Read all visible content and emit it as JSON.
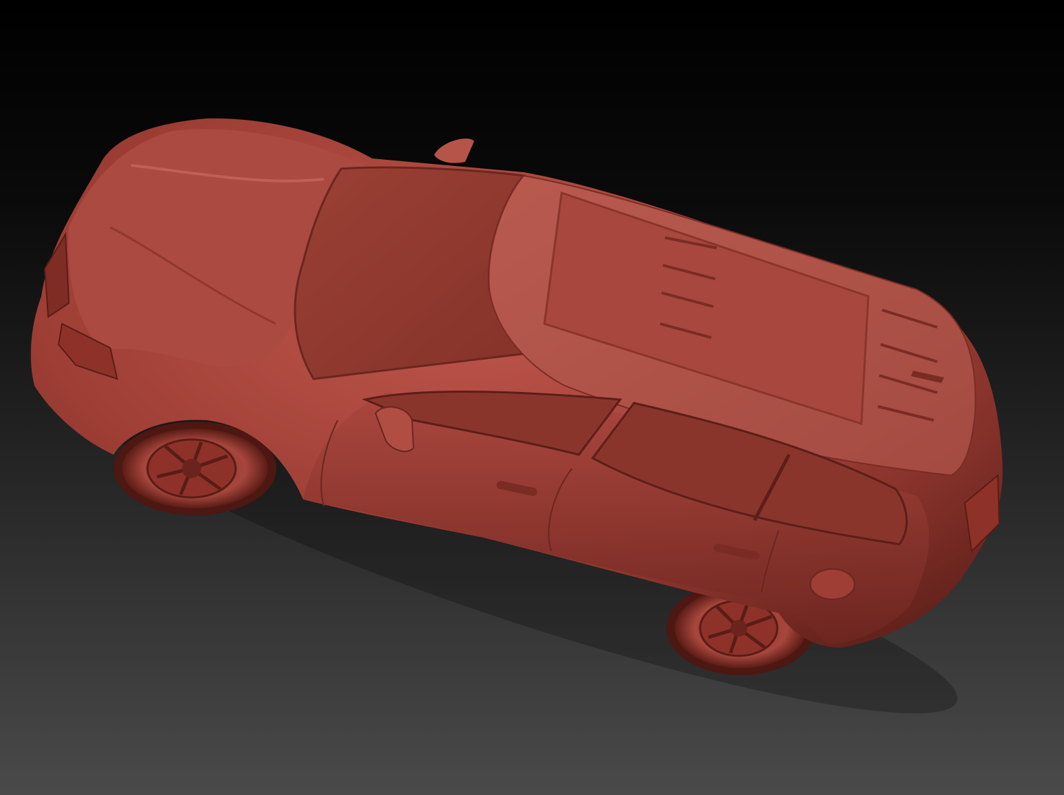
{
  "viewport": {
    "background_top": "#000000",
    "background_bottom": "#4a4a4a"
  },
  "model": {
    "material_color": "#a8433b",
    "highlight_color": "#c86a5e",
    "shadow_color": "#5a1d18",
    "parts": [
      "body",
      "hood",
      "windshield",
      "roof",
      "side-windows",
      "mirror",
      "door-handles",
      "front-wheel",
      "rear-wheel",
      "headlight",
      "fuel-cap"
    ]
  }
}
